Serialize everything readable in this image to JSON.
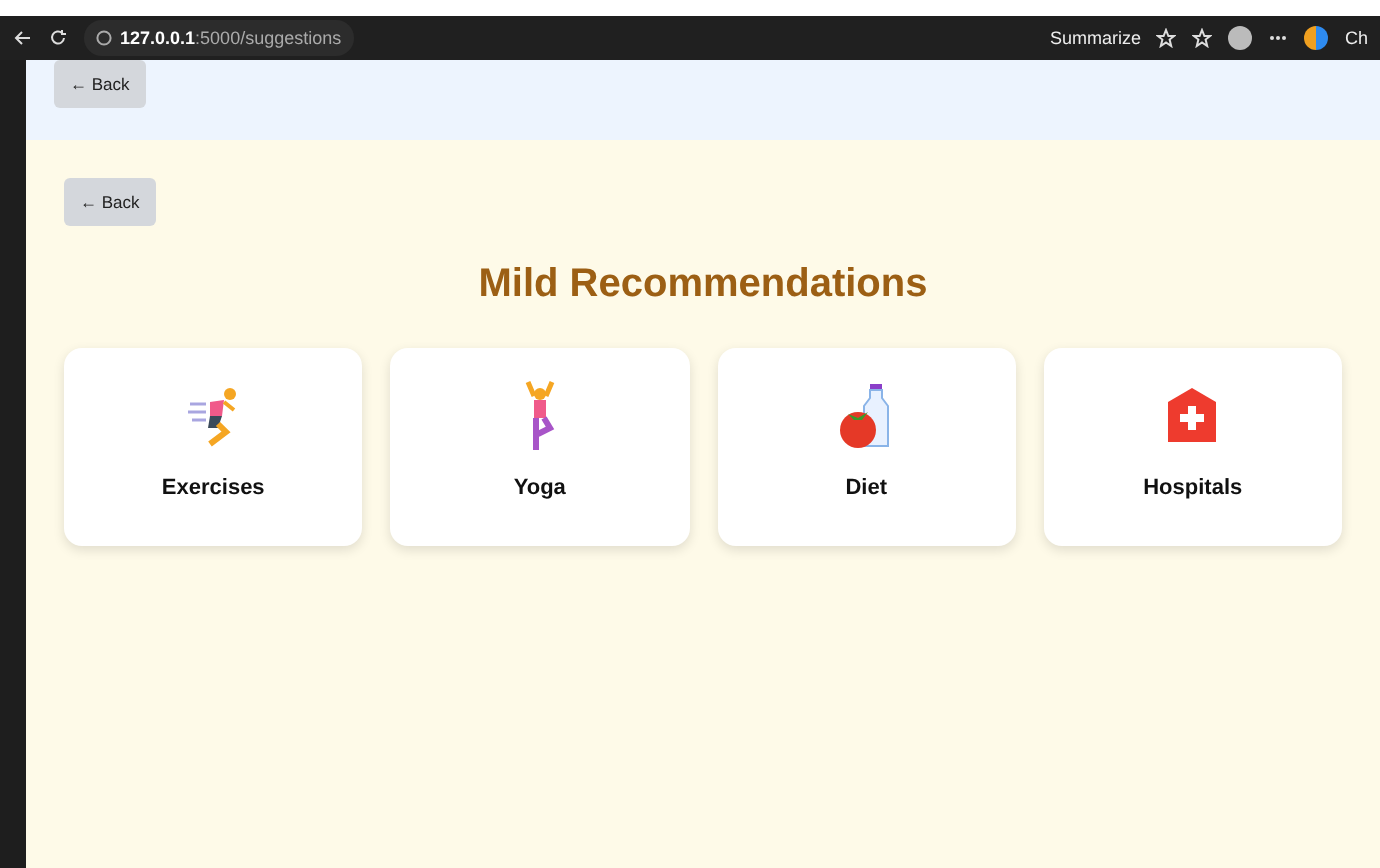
{
  "browser": {
    "url_host": "127.0.0.1",
    "url_path": ":5000/suggestions",
    "summarize": "Summarize",
    "copilot": "Ch"
  },
  "header": {
    "back": "← Back"
  },
  "page": {
    "back": "← Back",
    "title": "Mild Recommendations",
    "cards": [
      {
        "kind": "exercise",
        "label": "Exercises"
      },
      {
        "kind": "yoga",
        "label": "Yoga"
      },
      {
        "kind": "diet",
        "label": "Diet"
      },
      {
        "kind": "hospital",
        "label": "Hospitals"
      }
    ]
  }
}
